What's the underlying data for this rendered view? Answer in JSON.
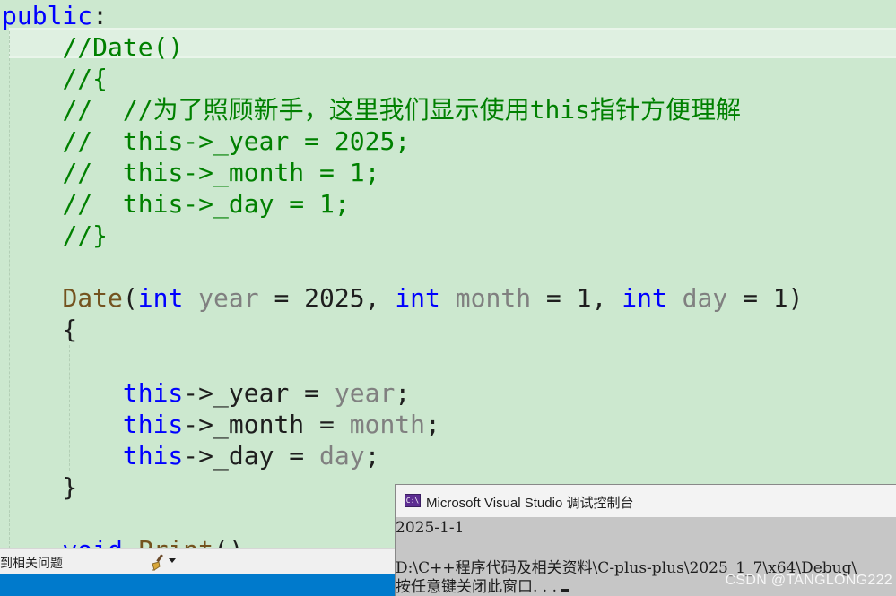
{
  "editor": {
    "lines": [
      {
        "id": "l1",
        "tokens": [
          {
            "c": "kw",
            "t": "public"
          },
          {
            "c": "tx",
            "t": ":"
          }
        ]
      },
      {
        "id": "l2",
        "tokens": [
          {
            "c": "tx",
            "t": "    "
          },
          {
            "c": "cm",
            "t": "//Date()"
          }
        ]
      },
      {
        "id": "l3",
        "tokens": [
          {
            "c": "tx",
            "t": "    "
          },
          {
            "c": "cm",
            "t": "//{"
          }
        ]
      },
      {
        "id": "l4",
        "tokens": [
          {
            "c": "tx",
            "t": "    "
          },
          {
            "c": "cm",
            "t": "//  //为了照顾新手，这里我们显示使用this指针方便理解"
          }
        ]
      },
      {
        "id": "l5",
        "tokens": [
          {
            "c": "tx",
            "t": "    "
          },
          {
            "c": "cm",
            "t": "//  this->_year = 2025;"
          }
        ]
      },
      {
        "id": "l6",
        "tokens": [
          {
            "c": "tx",
            "t": "    "
          },
          {
            "c": "cm",
            "t": "//  this->_month = 1;"
          }
        ]
      },
      {
        "id": "l7",
        "tokens": [
          {
            "c": "tx",
            "t": "    "
          },
          {
            "c": "cm",
            "t": "//  this->_day = 1;"
          }
        ]
      },
      {
        "id": "l8",
        "tokens": [
          {
            "c": "tx",
            "t": "    "
          },
          {
            "c": "cm",
            "t": "//}"
          }
        ]
      },
      {
        "id": "l9",
        "tokens": []
      },
      {
        "id": "l10",
        "tokens": [
          {
            "c": "tx",
            "t": "    "
          },
          {
            "c": "fn",
            "t": "Date"
          },
          {
            "c": "tx",
            "t": "("
          },
          {
            "c": "kw",
            "t": "int"
          },
          {
            "c": "tx",
            "t": " "
          },
          {
            "c": "pm",
            "t": "year"
          },
          {
            "c": "tx",
            "t": " = 2025, "
          },
          {
            "c": "kw",
            "t": "int"
          },
          {
            "c": "tx",
            "t": " "
          },
          {
            "c": "pm",
            "t": "month"
          },
          {
            "c": "tx",
            "t": " = 1, "
          },
          {
            "c": "kw",
            "t": "int"
          },
          {
            "c": "tx",
            "t": " "
          },
          {
            "c": "pm",
            "t": "day"
          },
          {
            "c": "tx",
            "t": " = 1)"
          }
        ]
      },
      {
        "id": "l11",
        "tokens": [
          {
            "c": "tx",
            "t": "    {"
          }
        ]
      },
      {
        "id": "l12",
        "tokens": []
      },
      {
        "id": "l13",
        "tokens": [
          {
            "c": "tx",
            "t": "        "
          },
          {
            "c": "kw",
            "t": "this"
          },
          {
            "c": "tx",
            "t": "->_year = "
          },
          {
            "c": "pm",
            "t": "year"
          },
          {
            "c": "tx",
            "t": ";"
          }
        ]
      },
      {
        "id": "l14",
        "tokens": [
          {
            "c": "tx",
            "t": "        "
          },
          {
            "c": "kw",
            "t": "this"
          },
          {
            "c": "tx",
            "t": "->_month = "
          },
          {
            "c": "pm",
            "t": "month"
          },
          {
            "c": "tx",
            "t": ";"
          }
        ]
      },
      {
        "id": "l15",
        "tokens": [
          {
            "c": "tx",
            "t": "        "
          },
          {
            "c": "kw",
            "t": "this"
          },
          {
            "c": "tx",
            "t": "->_day = "
          },
          {
            "c": "pm",
            "t": "day"
          },
          {
            "c": "tx",
            "t": ";"
          }
        ]
      },
      {
        "id": "l16",
        "tokens": [
          {
            "c": "tx",
            "t": "    }"
          }
        ]
      },
      {
        "id": "l17",
        "tokens": []
      },
      {
        "id": "l18",
        "tokens": [
          {
            "c": "tx",
            "t": "    "
          },
          {
            "c": "kw",
            "t": "void"
          },
          {
            "c": "tx",
            "t": " "
          },
          {
            "c": "fn",
            "t": "Print"
          },
          {
            "c": "tx",
            "t": "()"
          }
        ]
      }
    ]
  },
  "statusbar": {
    "issues_label": "到相关问题",
    "brush_icon": "cleanup-brush-icon",
    "dropdown_icon": "chevron-down-icon"
  },
  "console": {
    "title": "Microsoft Visual Studio 调试控制台",
    "app_icon": "C:\\",
    "lines": [
      "2025-1-1",
      "",
      "D:\\C++程序代码及相关资料\\C-plus-plus\\2025_1_7\\x64\\Debug\\",
      "按任意键关闭此窗口. . ."
    ]
  },
  "watermark": "CSDN @TANGLONG222",
  "colors": {
    "editor_bg": "#cce8cf",
    "keyword": "#0000ff",
    "comment": "#008000",
    "function": "#74531f",
    "parameter": "#808080",
    "statusbar_accent": "#007acc"
  }
}
